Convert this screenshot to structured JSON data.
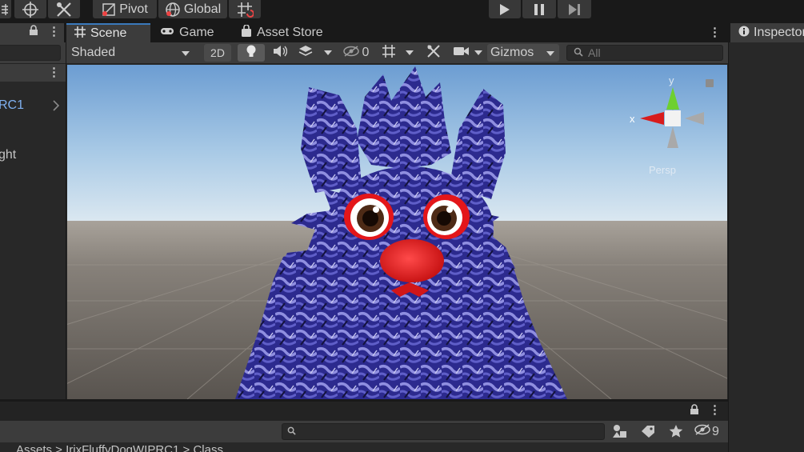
{
  "toolbar": {
    "pivot_label": "Pivot",
    "global_label": "Global"
  },
  "hierarchy": {
    "row_a_label": "RC1",
    "row_b_label": "ght"
  },
  "scene": {
    "tabs": [
      {
        "label": "Scene",
        "icon": "grid-icon",
        "active": true
      },
      {
        "label": "Game",
        "icon": "gamepad-icon",
        "active": false
      },
      {
        "label": "Asset Store",
        "icon": "bag-icon",
        "active": false
      }
    ],
    "shading_mode": "Shaded",
    "mode_2d_label": "2D",
    "hidden_count": "0",
    "gizmos_label": "Gizmos",
    "search_placeholder": "All",
    "gizmo": {
      "x_label": "x",
      "y_label": "y",
      "projection_label": "Persp"
    }
  },
  "inspector": {
    "tab_label": "Inspector"
  },
  "project": {
    "hidden_count": "9",
    "breadcrumb": "Assets > IrixFluffyDogWIPRC1 > Class"
  },
  "colors": {
    "accent": "#3a79bb",
    "panel": "#3c3c3c",
    "dark_bg": "#191919",
    "fur_blue": "#2a2890",
    "nose_red": "#e81d1d"
  }
}
